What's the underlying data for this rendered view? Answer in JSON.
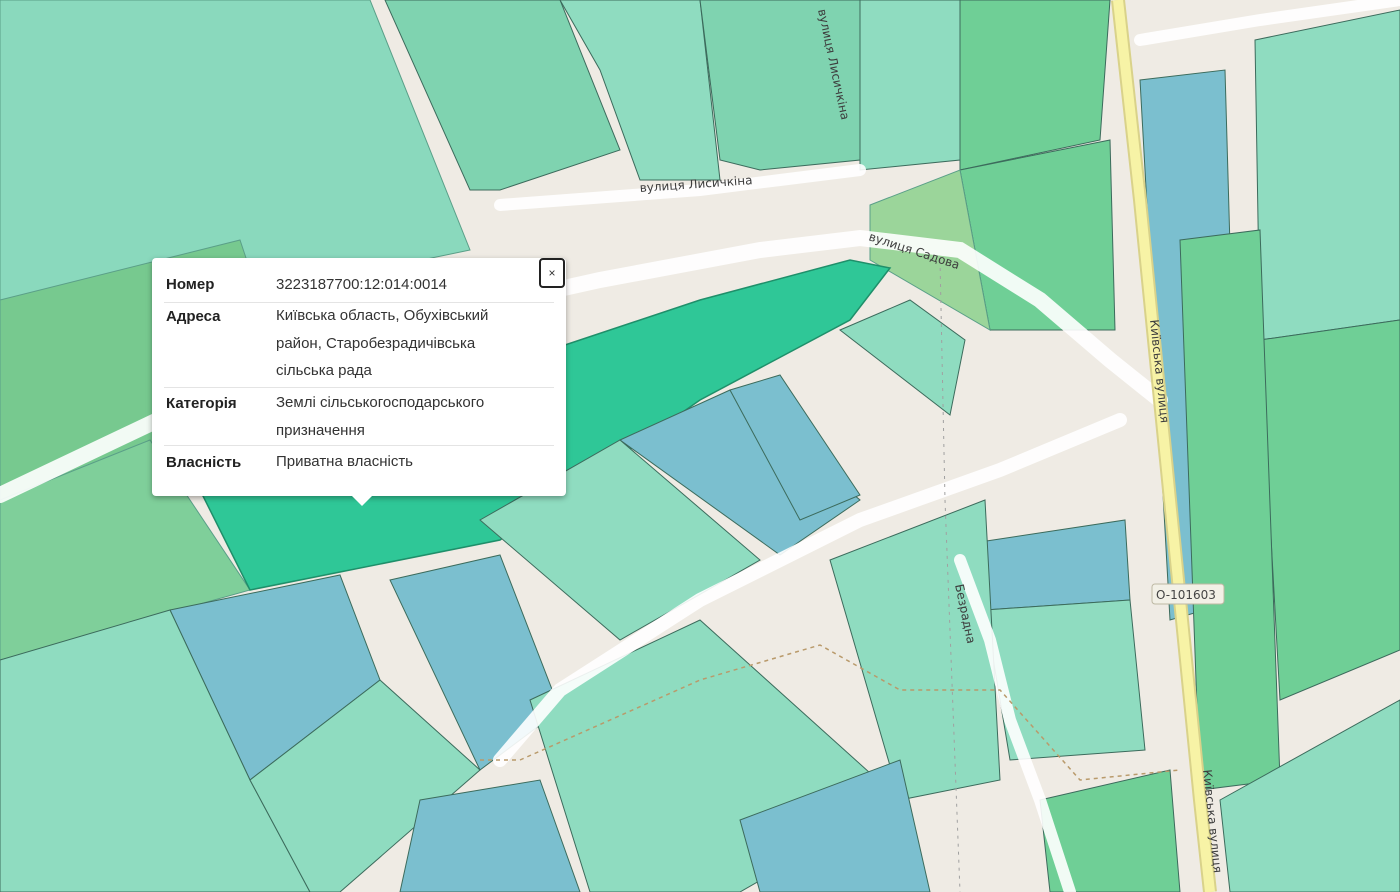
{
  "map": {
    "street_labels": {
      "lysychkina_horizontal": "вулиця Лисичкіна",
      "lysychkina_vertical": "вулиця Лисичкіна",
      "sadova": "вулиця Садова",
      "kyivska_upper": "Київська вулиця",
      "kyivska_lower": "Київська вулиця",
      "bezradna": "Безрадна"
    },
    "road_ref": "O-101603",
    "colors": {
      "background": "#efebe4",
      "parcel_private": "#7fd9b8",
      "parcel_selected": "#2fc797",
      "parcel_state": "#7bbfcf",
      "vegetation": "#9bd59a",
      "main_road": "#f7f3a6"
    }
  },
  "popup": {
    "rows": [
      {
        "key": "Номер",
        "value": "3223187700:12:014:0014"
      },
      {
        "key": "Адреса",
        "value": "Київська область, Обухівський район, Старобезрадичівська сільська рада"
      },
      {
        "key": "Категорія",
        "value": "Землі сільськогосподарського призначення"
      },
      {
        "key": "Власність",
        "value": "Приватна власність"
      }
    ],
    "close_label": "×"
  }
}
